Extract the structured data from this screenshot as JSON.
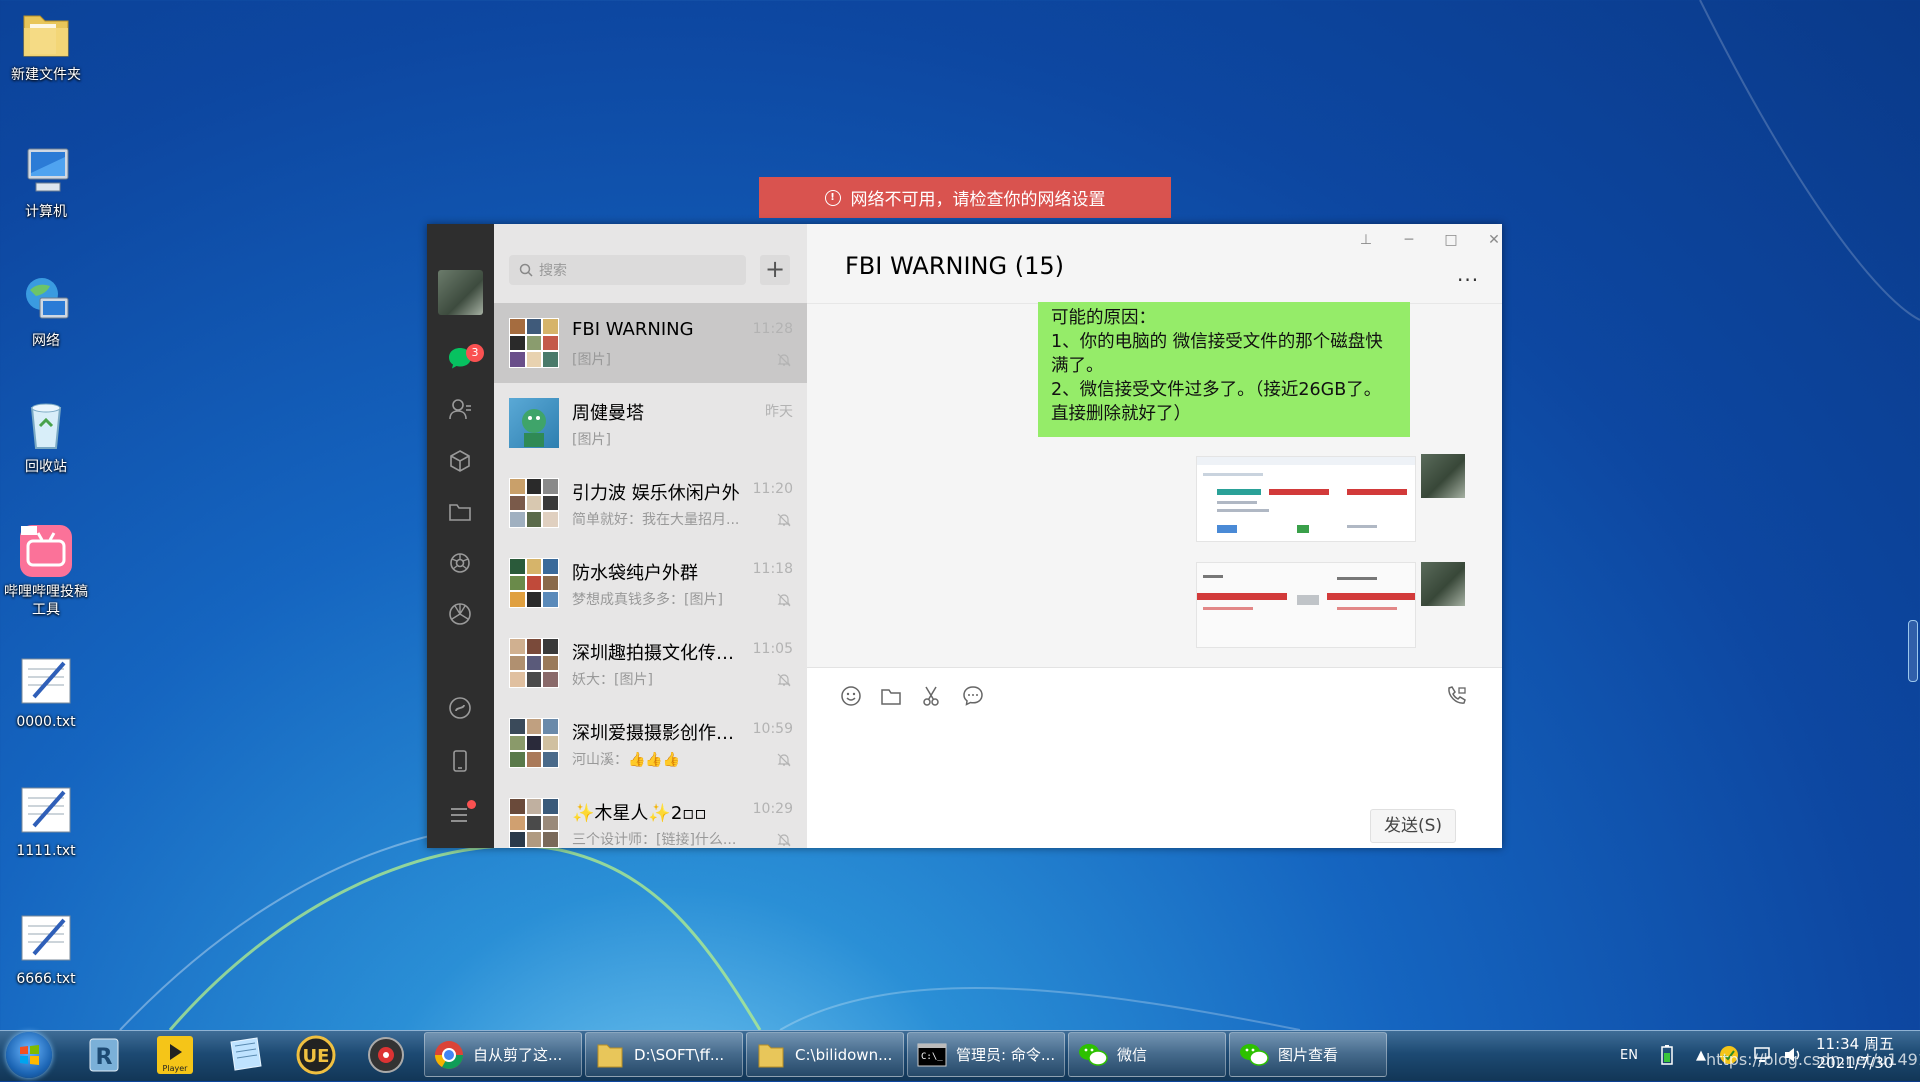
{
  "desktop": {
    "icons": [
      {
        "label": "新建文件夹",
        "icon": "folder-icon"
      },
      {
        "label": "计算机",
        "icon": "computer-icon"
      },
      {
        "label": "网络",
        "icon": "network-icon"
      },
      {
        "label": "回收站",
        "icon": "recycle-bin-icon"
      },
      {
        "label": "哔哩哔哩投稿工具",
        "icon": "bilibili-icon"
      },
      {
        "label": "0000.txt",
        "icon": "text-file-icon"
      },
      {
        "label": "1111.txt",
        "icon": "text-file-icon"
      },
      {
        "label": "6666.txt",
        "icon": "text-file-icon"
      }
    ]
  },
  "banner": {
    "text": "网络不可用，请检查你的网络设置",
    "color": "#d9534f"
  },
  "wechat": {
    "badge_count": "3",
    "search_placeholder": "搜索",
    "plus_label": "+",
    "conversations": [
      {
        "name": "FBI WARNING",
        "time": "11:28",
        "preview": "[图片]",
        "muted": true,
        "active": true
      },
      {
        "name": "周健曼塔",
        "time": "昨天",
        "preview": "[图片]",
        "muted": false,
        "active": false
      },
      {
        "name": "引力波 娱乐休闲户外",
        "time": "11:20",
        "preview": "简单就好：我在大量招月...",
        "muted": true,
        "active": false
      },
      {
        "name": "防水袋纯户外群",
        "time": "11:18",
        "preview": "梦想成真钱多多：[图片]",
        "muted": true,
        "active": false
      },
      {
        "name": "深圳趣拍摄文化传媒...",
        "time": "11:05",
        "preview": "妖大：[图片]",
        "muted": true,
        "active": false
      },
      {
        "name": "深圳爱摄摄影创作活...",
        "time": "10:59",
        "preview": "河山溪：👍👍👍",
        "muted": true,
        "active": false
      },
      {
        "name": "✨木星人✨2▫▫",
        "time": "10:29",
        "preview": "三个设计师：[链接]什么...",
        "muted": true,
        "active": false
      }
    ],
    "chat": {
      "title": "FBI WARNING (15)",
      "more": "...",
      "window_controls": {
        "pin": "⊥",
        "minimize": "─",
        "maximize": "□",
        "close": "✕"
      },
      "message_lines": [
        "可能的原因：",
        "1、你的电脑的 微信接受文件的那个磁盘快满了。",
        "2、微信接受文件过多了。（接近26GB了。直接删除就好了）"
      ],
      "send_label": "发送(S)"
    },
    "accent": "#95ec69"
  },
  "taskbar": {
    "tasks": [
      {
        "label": "自从剪了这...",
        "icon": "chrome-icon"
      },
      {
        "label": "D:\\SOFT\\ff...",
        "icon": "folder-icon"
      },
      {
        "label": "C:\\bilidown...",
        "icon": "folder-icon"
      },
      {
        "label": "管理员: 命令...",
        "icon": "cmd-icon"
      },
      {
        "label": "微信",
        "icon": "wechat-icon"
      },
      {
        "label": "图片查看",
        "icon": "wechat-icon"
      }
    ],
    "lang": "EN",
    "clock_time": "11:34 周五",
    "clock_date": "2021/7/30",
    "watermark": "https://blog.csdn.net/u14916"
  }
}
